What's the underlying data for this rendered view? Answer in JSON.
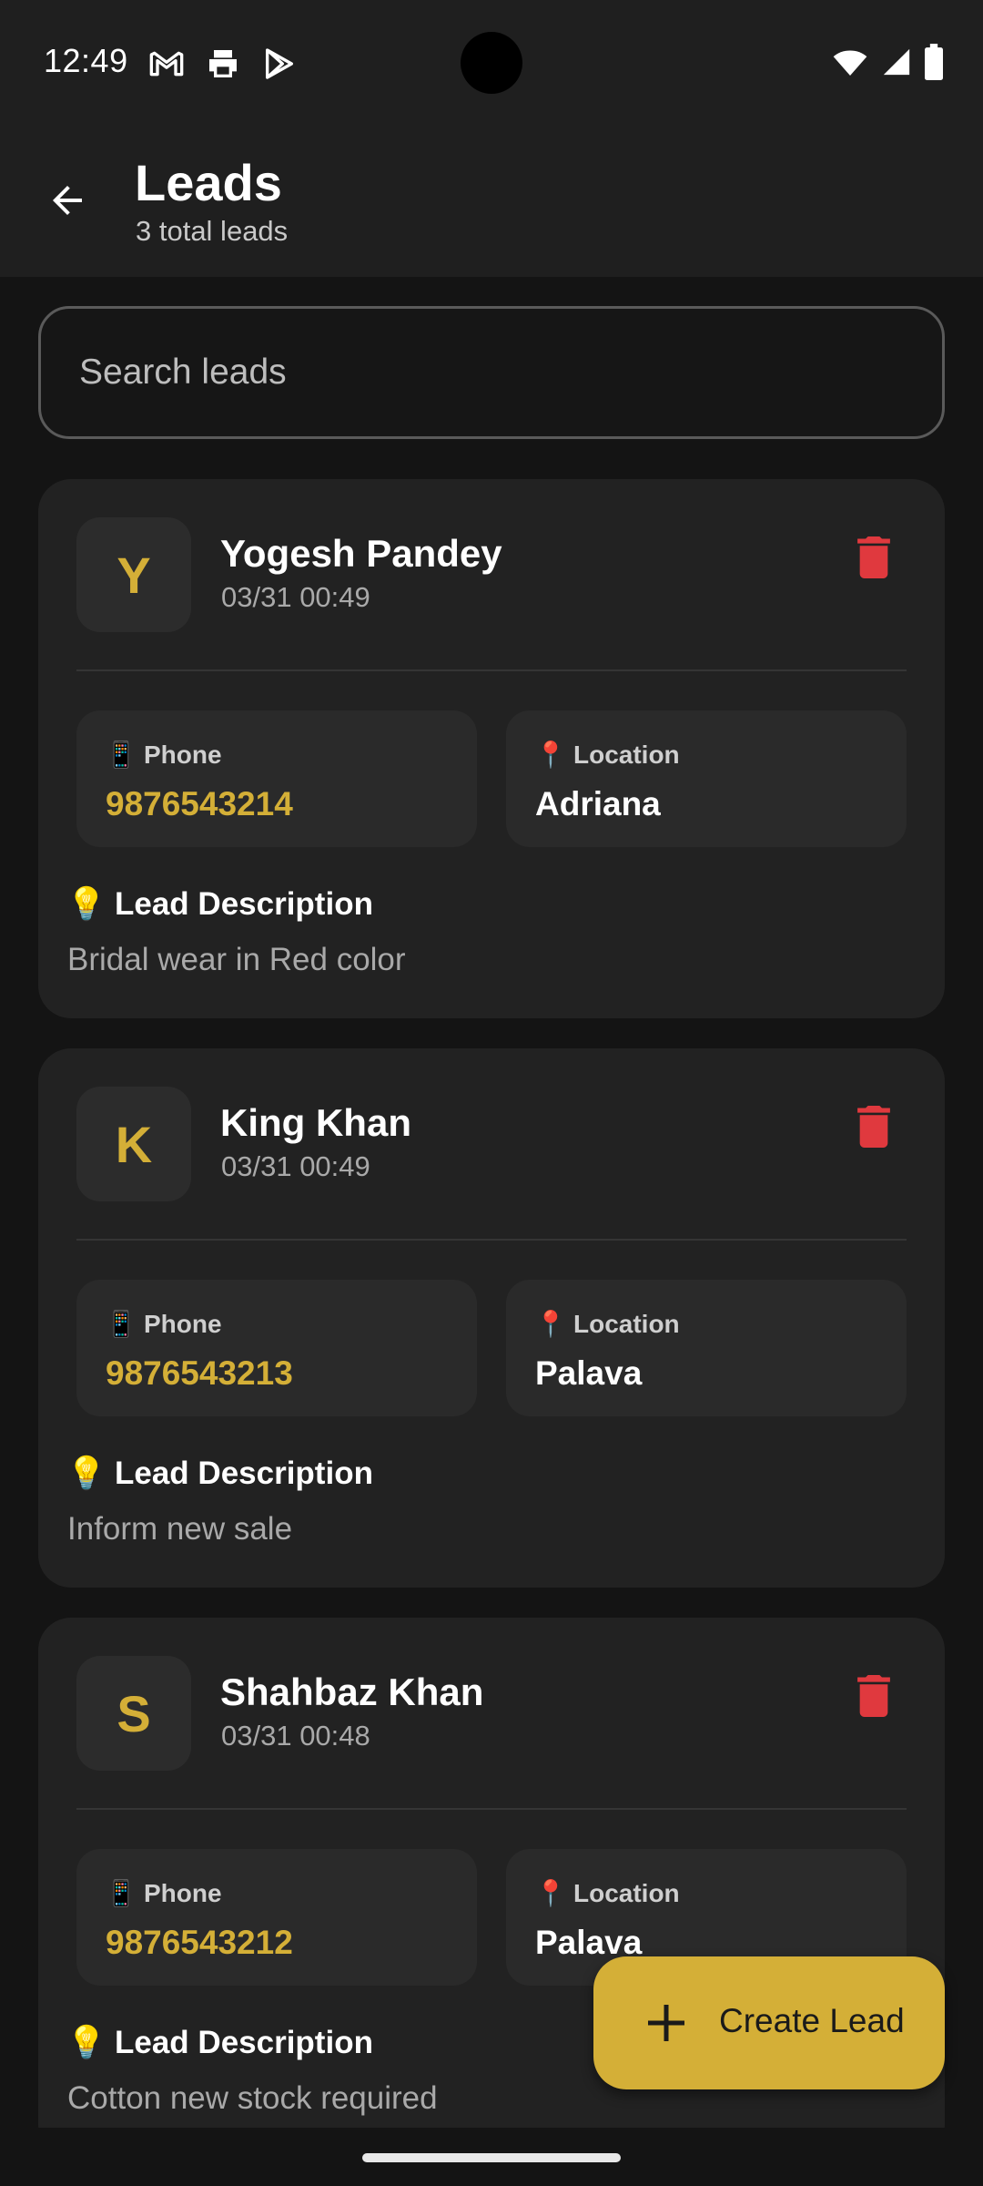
{
  "status_bar": {
    "time": "12:49",
    "left_icons": [
      "gmail-icon",
      "print-icon",
      "play-store-icon"
    ],
    "right_icons": [
      "wifi-icon",
      "signal-icon",
      "battery-icon"
    ]
  },
  "app_bar": {
    "title": "Leads",
    "subtitle": "3 total leads"
  },
  "search": {
    "placeholder": "Search leads"
  },
  "labels": {
    "phone": "Phone",
    "location": "Location",
    "description": "Lead Description",
    "phone_emoji": "📱",
    "location_emoji": "📍",
    "description_emoji": "💡"
  },
  "leads": [
    {
      "initial": "Y",
      "name": "Yogesh Pandey",
      "date": "03/31 00:49",
      "phone": "9876543214",
      "location": "Adriana",
      "description": "Bridal wear in Red color"
    },
    {
      "initial": "K",
      "name": "King Khan",
      "date": "03/31 00:49",
      "phone": "9876543213",
      "location": "Palava",
      "description": "Inform new sale"
    },
    {
      "initial": "S",
      "name": "Shahbaz Khan",
      "date": "03/31 00:48",
      "phone": "9876543212",
      "location": "Palava",
      "description": "Cotton new stock required"
    }
  ],
  "fab": {
    "label": "Create Lead"
  },
  "colors": {
    "accent": "#d4af37",
    "delete": "#e0393e",
    "background": "#141414",
    "card": "#222222"
  }
}
